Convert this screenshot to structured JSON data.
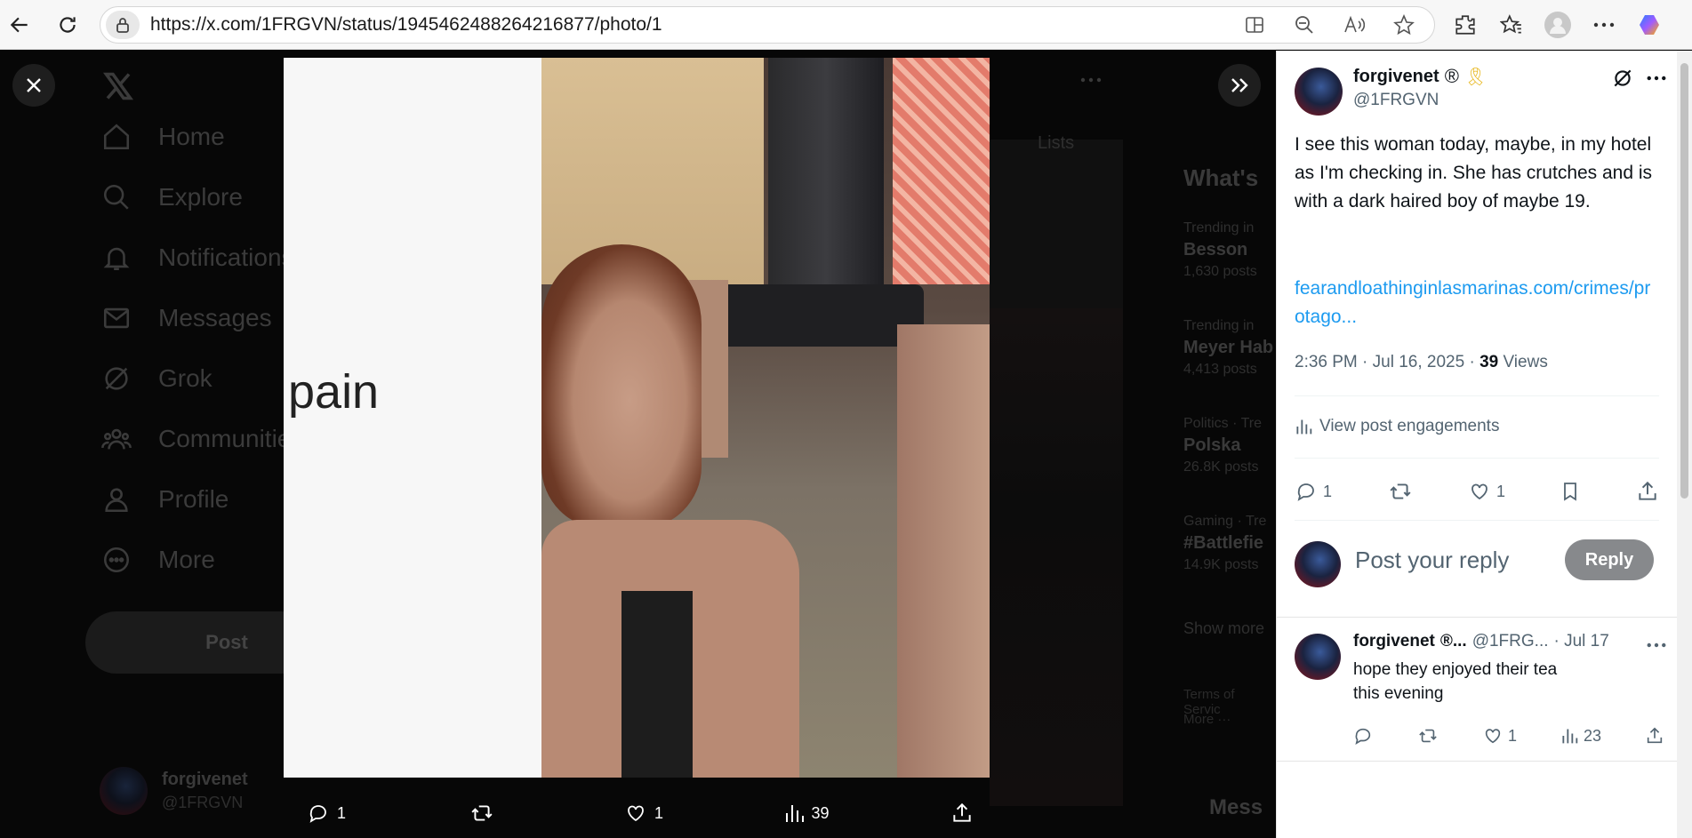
{
  "browser": {
    "url": "https://x.com/1FRGVN/status/1945462488264216877/photo/1"
  },
  "background_nav": {
    "items": [
      {
        "label": "Home"
      },
      {
        "label": "Explore"
      },
      {
        "label": "Notifications"
      },
      {
        "label": "Messages"
      },
      {
        "label": "Grok"
      },
      {
        "label": "Communities"
      },
      {
        "label": "Profile"
      },
      {
        "label": "More"
      }
    ],
    "post_label": "Post",
    "account_name": "forgivenet",
    "account_handle": "@1FRGVN"
  },
  "background_side": {
    "tabs_label": "Lists",
    "heading": "What's",
    "trends": [
      {
        "category": "Trending in",
        "name": "Besson",
        "count": "1,630 posts"
      },
      {
        "category": "Trending in",
        "name": "Meyer Hab",
        "count": "4,413 posts"
      },
      {
        "category": "Politics · Tre",
        "name": "Polska",
        "count": "26.8K posts"
      },
      {
        "category": "Gaming · Tre",
        "name": "#Battlefie",
        "count": "14.9K posts"
      }
    ],
    "show_more": "Show more",
    "footer": "Terms of Servic",
    "footer2": "More ···",
    "messages": "Mess"
  },
  "photo": {
    "visible_text": "pain"
  },
  "photo_actions": {
    "replies": "1",
    "reposts": "",
    "likes": "1",
    "views": "39"
  },
  "post": {
    "author_name": "forgivenet",
    "author_handle": "@1FRGVN",
    "text_line": "I see this woman today, maybe, in my hotel as I'm checking in. She has crutches and is with a dark haired boy of maybe 19.",
    "link": "fearandloathinginlasmarinas.com/crimes/protago...",
    "timestamp": "2:36 PM · Jul 16, 2025 · ",
    "views_count": "39",
    "views_label": " Views",
    "engagements_label": "View post engagements",
    "stats": {
      "replies": "1",
      "likes": "1"
    }
  },
  "reply_box": {
    "placeholder": "Post your reply",
    "button": "Reply"
  },
  "reply": {
    "author_name": "forgivenet",
    "author_handle": "@1FRG...",
    "date": "· Jul 17",
    "text": "hope they enjoyed their tea this evening",
    "likes": "1",
    "views": "23"
  }
}
